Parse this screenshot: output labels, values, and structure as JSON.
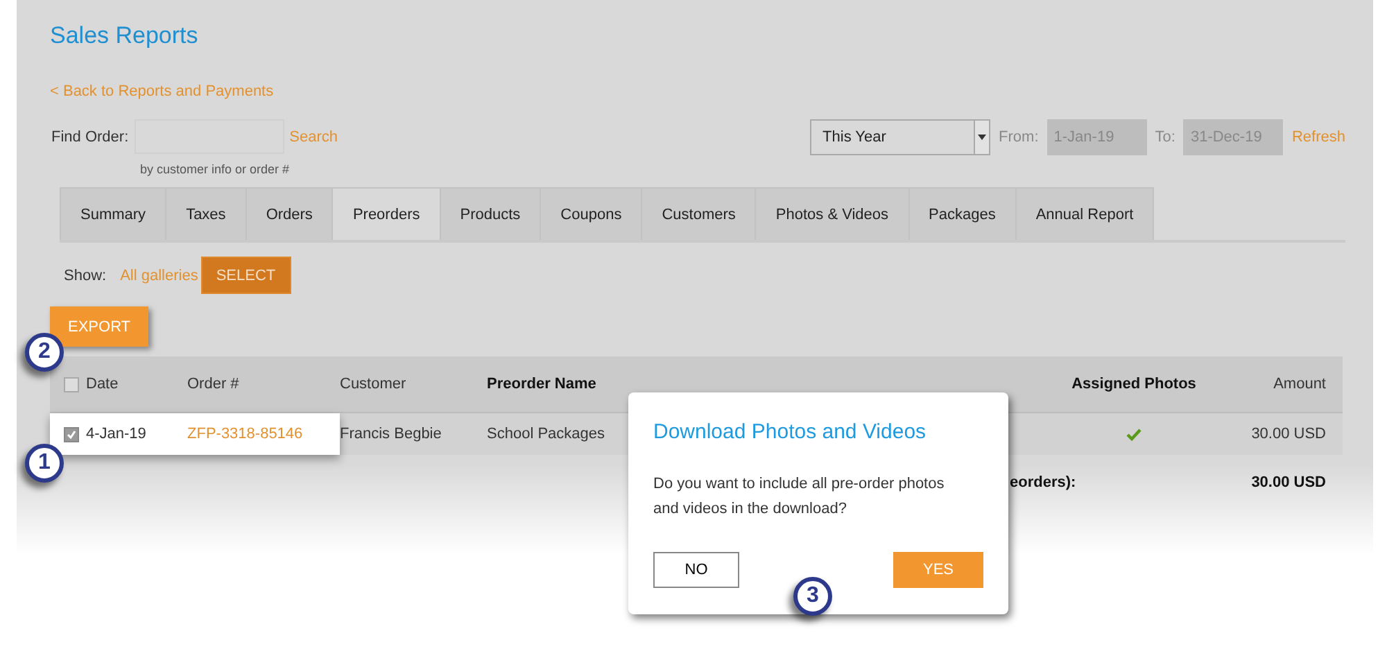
{
  "title": "Sales Reports",
  "back_link": "< Back to Reports and Payments",
  "find_order": {
    "label": "Find Order:",
    "hint": "by customer info or order #",
    "search": "Search"
  },
  "period": {
    "value": "This Year",
    "from_label": "From:",
    "from": "1-Jan-19",
    "to_label": "To:",
    "to": "31-Dec-19",
    "refresh": "Refresh"
  },
  "tabs": [
    {
      "label": "Summary",
      "selected": false
    },
    {
      "label": "Taxes",
      "selected": false
    },
    {
      "label": "Orders",
      "selected": false
    },
    {
      "label": "Preorders",
      "selected": true
    },
    {
      "label": "Products",
      "selected": false
    },
    {
      "label": "Coupons",
      "selected": false
    },
    {
      "label": "Customers",
      "selected": false
    },
    {
      "label": "Photos & Videos",
      "selected": false
    },
    {
      "label": "Packages",
      "selected": false
    },
    {
      "label": "Annual Report",
      "selected": false
    }
  ],
  "show": {
    "label": "Show:",
    "all_galleries": "All galleries",
    "select": "SELECT"
  },
  "export": "EXPORT",
  "table": {
    "all_checked": false,
    "columns": [
      "Date",
      "Order #",
      "Customer",
      "Preorder Name",
      "Assigned Photos",
      "Amount"
    ],
    "rows": [
      {
        "checked": true,
        "date": "4-Jan-19",
        "order": "ZFP-3318-85146",
        "customer": "Francis Begbie",
        "preorder_name": "School Packages",
        "assigned": true,
        "amount": "30.00 USD"
      }
    ],
    "total_label": "eorders):",
    "total": "30.00 USD"
  },
  "dialog": {
    "title": "Download Photos and Videos",
    "text": "Do you want to include all pre-order photos and videos in the download?",
    "no": "NO",
    "yes": "YES"
  },
  "callouts": [
    "2",
    "1",
    "3"
  ]
}
